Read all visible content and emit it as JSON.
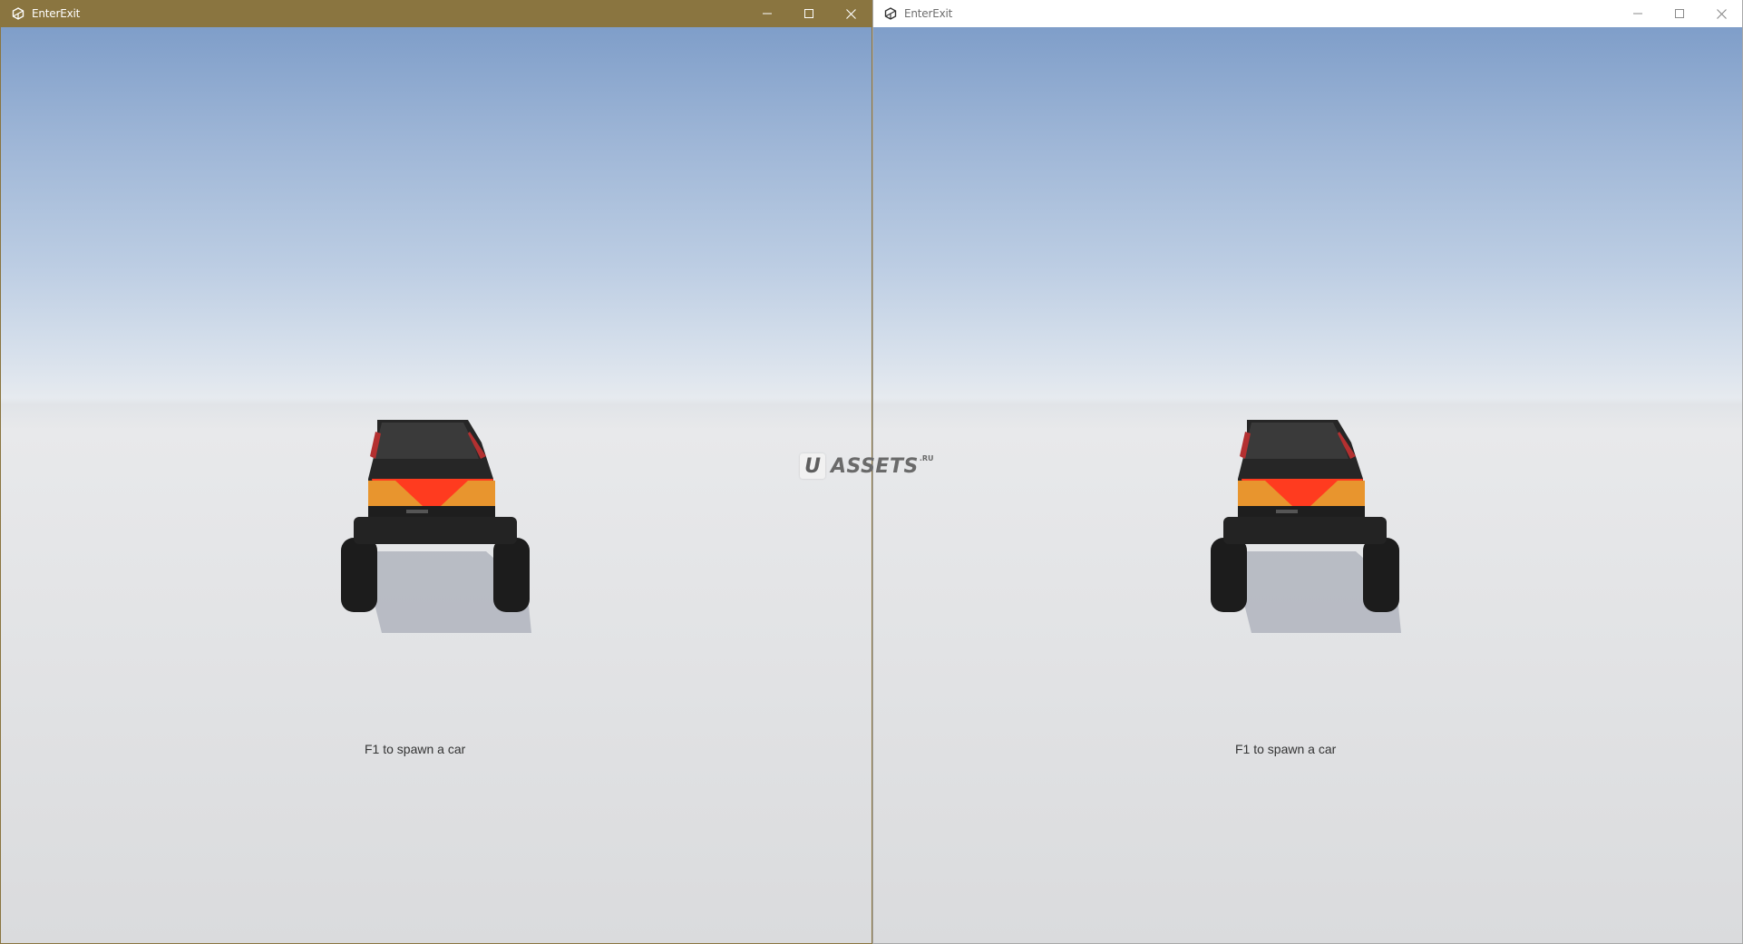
{
  "windows": [
    {
      "title": "EnterExit",
      "active": true,
      "hint": "F1 to spawn a car",
      "controls": {
        "minimize": "minimize-icon",
        "maximize": "maximize-icon",
        "close": "close-icon"
      }
    },
    {
      "title": "EnterExit",
      "active": false,
      "hint": "F1 to spawn a car",
      "controls": {
        "minimize": "minimize-icon",
        "maximize": "maximize-icon",
        "close": "close-icon"
      }
    }
  ],
  "watermark": {
    "letter": "U",
    "word": "ASSETS",
    "suffix": ".RU"
  },
  "colors": {
    "active_titlebar": "#8a7540",
    "inactive_titlebar": "#ffffff",
    "sky_top": "#7f9ec9",
    "ground": "#e4e5e7",
    "tail_light": "#ff3b1f",
    "side_light": "#e8952e"
  }
}
